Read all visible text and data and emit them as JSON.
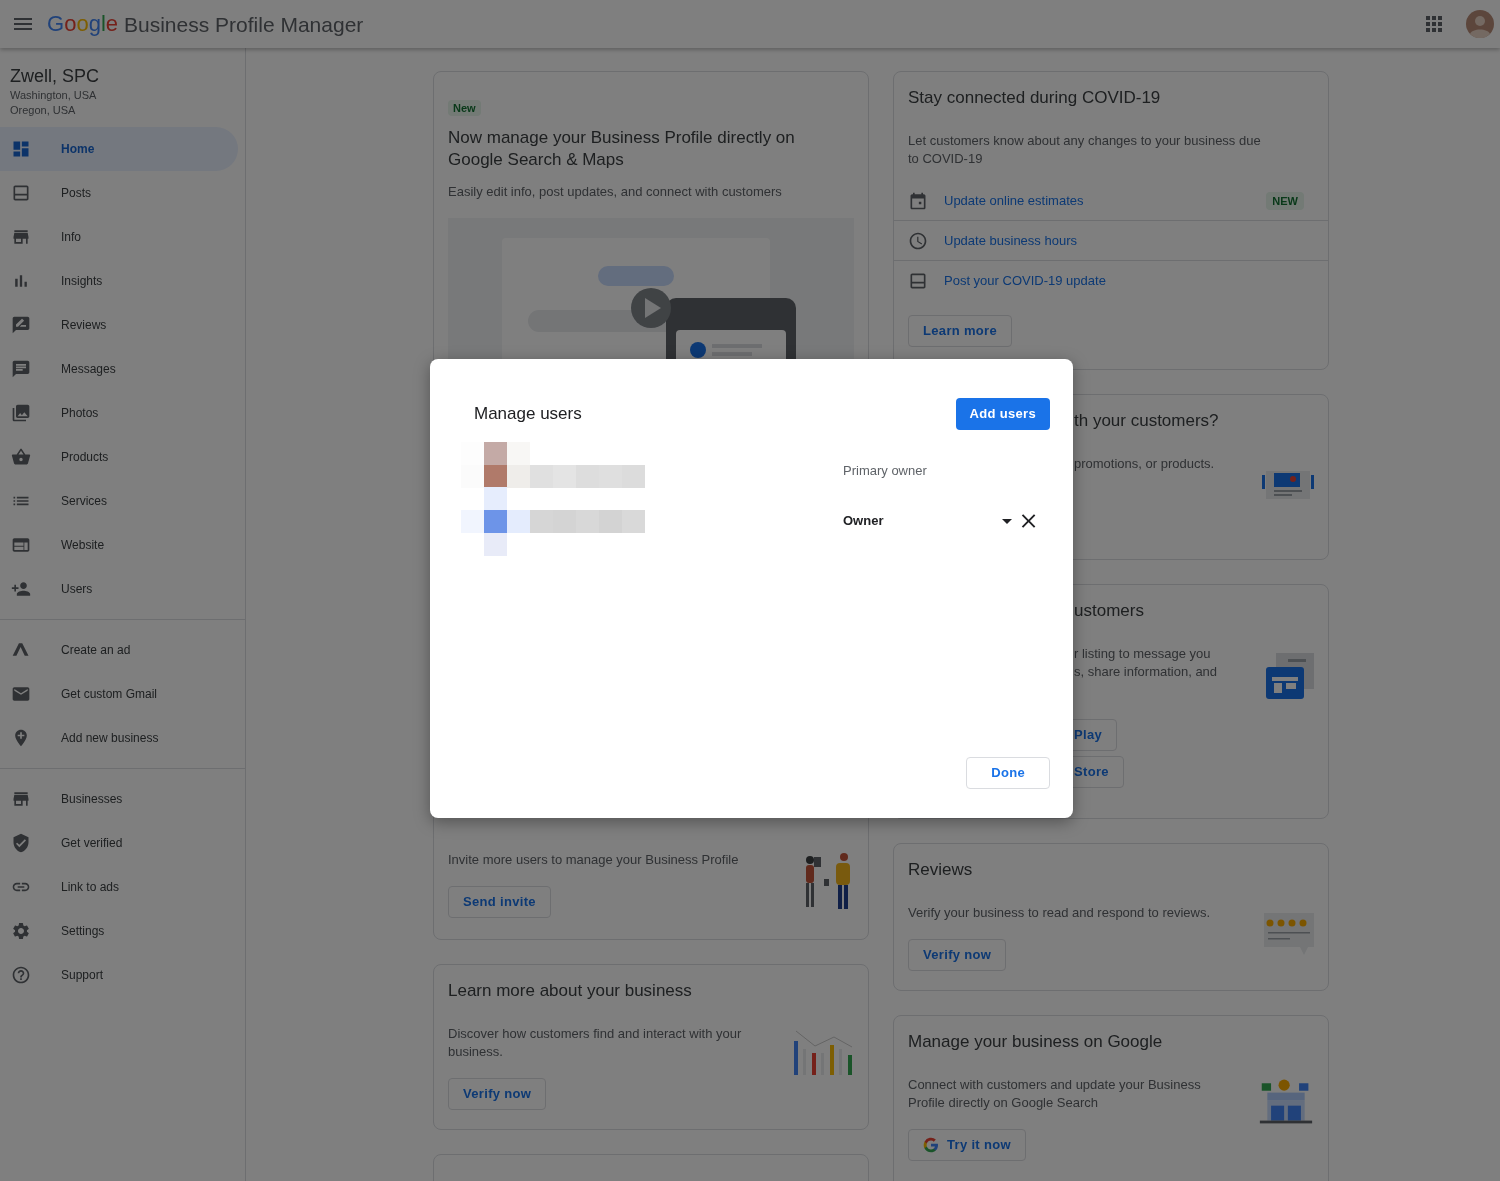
{
  "header": {
    "logo": "Google",
    "title": "Business Profile Manager"
  },
  "sidebar": {
    "business": {
      "name": "Zwell, SPC",
      "locations": [
        "Washington, USA",
        "Oregon, USA"
      ]
    },
    "groups": [
      {
        "items": [
          {
            "label": "Home",
            "selected": true
          },
          {
            "label": "Posts",
            "selected": false
          },
          {
            "label": "Info",
            "selected": false
          },
          {
            "label": "Insights",
            "selected": false
          },
          {
            "label": "Reviews",
            "selected": false
          },
          {
            "label": "Messages",
            "selected": false
          },
          {
            "label": "Photos",
            "selected": false
          },
          {
            "label": "Products",
            "selected": false
          },
          {
            "label": "Services",
            "selected": false
          },
          {
            "label": "Website",
            "selected": false
          },
          {
            "label": "Users",
            "selected": false
          }
        ]
      },
      {
        "items": [
          {
            "label": "Create an ad",
            "selected": false
          },
          {
            "label": "Get custom Gmail",
            "selected": false
          },
          {
            "label": "Add new business",
            "selected": false
          }
        ]
      },
      {
        "items": [
          {
            "label": "Businesses",
            "selected": false
          },
          {
            "label": "Get verified",
            "selected": false
          },
          {
            "label": "Link to ads",
            "selected": false
          },
          {
            "label": "Settings",
            "selected": false
          },
          {
            "label": "Support",
            "selected": false
          }
        ]
      }
    ]
  },
  "cards_left": [
    {
      "kind": "video",
      "badge": "New",
      "title": "Now manage your Business Profile directly on Google Search & Maps",
      "text": [
        "Easily edit info, post updates, and connect with customers"
      ]
    },
    {
      "kind": "standard",
      "text": [
        "Invite more users to manage your Business Profile"
      ],
      "buttons": [
        "Send invite"
      ]
    },
    {
      "kind": "standard",
      "title": "Learn more about your business",
      "text": [
        "Discover how customers find and interact with your business."
      ],
      "buttons": [
        "Verify now"
      ]
    },
    {
      "kind": "standard"
    }
  ],
  "cards_right": [
    {
      "kind": "links",
      "title": "Stay connected during COVID-19",
      "text": [
        "Let customers know about any changes to your business due to COVID-19"
      ],
      "links": [
        {
          "label": "Update online estimates",
          "badge": "NEW"
        },
        {
          "label": "Update business hours"
        },
        {
          "label": "Post your COVID-19 update"
        }
      ],
      "buttons": [
        "Learn more"
      ]
    },
    {
      "kind": "covered",
      "title": "th your customers?",
      "text": [
        "promotions, or products."
      ]
    },
    {
      "kind": "covered",
      "title": "ustomers",
      "text": [
        "r listing to message you",
        "s, share information, and"
      ],
      "buttons": [
        "Play",
        "Store"
      ]
    },
    {
      "kind": "standard",
      "title": "Reviews",
      "text": [
        "Verify your business to read and respond to reviews."
      ],
      "buttons": [
        "Verify now"
      ]
    },
    {
      "kind": "standard",
      "title": "Manage your business on Google",
      "text": [
        "Connect with customers and update your Business Profile directly on Google Search"
      ],
      "buttons": [
        "Try it now"
      ]
    }
  ],
  "dialog": {
    "title": "Manage users",
    "add_button": "Add users",
    "users": [
      {
        "kind": "fixed",
        "role": "Primary owner"
      },
      {
        "kind": "select",
        "role": "Owner"
      }
    ],
    "done_button": "Done"
  }
}
